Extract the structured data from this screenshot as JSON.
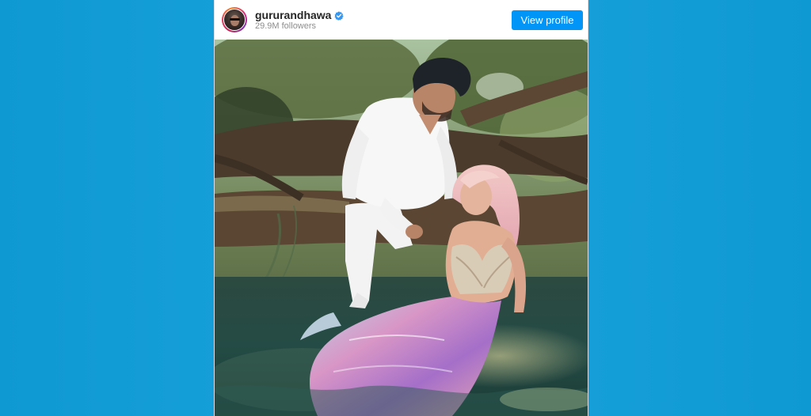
{
  "embed": {
    "username": "gururandhawa",
    "followers": "29.9M followers",
    "view_profile_label": "View profile",
    "avatar_icon": "avatar-icon",
    "verified_icon": "verified-badge-icon",
    "accent_color": "#0095f6"
  },
  "page": {
    "background_color": "#0f99d3"
  }
}
